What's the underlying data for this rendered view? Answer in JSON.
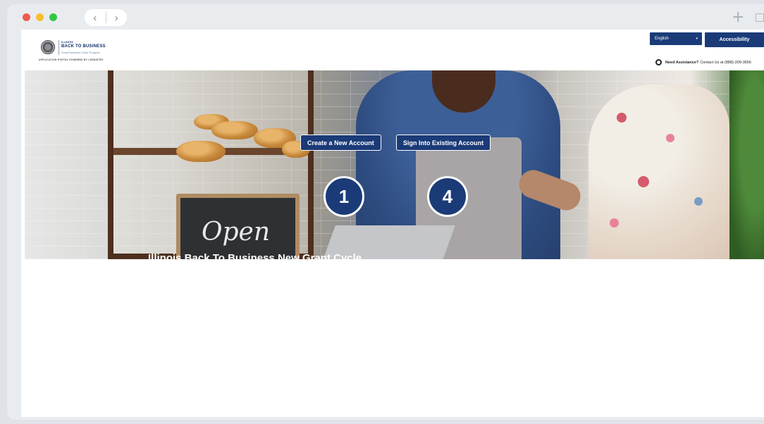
{
  "browser": {
    "back_icon": "chevron-left-icon",
    "forward_icon": "chevron-right-icon",
    "new_tab_icon": "plus-icon",
    "copy_icon": "copy-icon",
    "traffic_lights": [
      "#f05a4f",
      "#f5bf2f",
      "#34c648"
    ]
  },
  "header": {
    "logo_small": "ILLINOIS",
    "logo_main": "BACK TO BUSINESS",
    "logo_sub": "Small Business Grant Program",
    "powered_by": "APPLICATION PORTAL POWERED BY LENDISTRY",
    "language": "English",
    "accessibility": "Accessibility",
    "assist_label": "Need Assistance?",
    "assist_text": "Contact Us at (888)-209-3656"
  },
  "hero": {
    "create_account": "Create a New Account",
    "sign_in": "Sign Into Existing Account",
    "sign_text": "Open",
    "headline": "Illinois Back To Business New Grant Cycle"
  },
  "markers": [
    "1",
    "4"
  ],
  "colors": {
    "brand_navy": "#1b3b78",
    "window_bg": "#e9ecef"
  }
}
